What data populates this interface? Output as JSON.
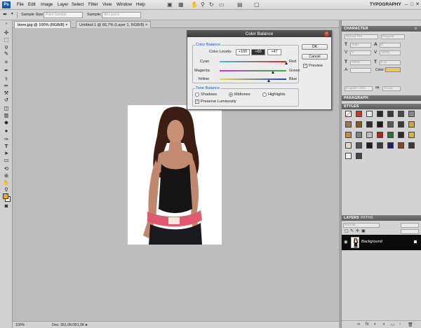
{
  "app": {
    "logo": "Ps"
  },
  "menu": [
    "File",
    "Edit",
    "Image",
    "Layer",
    "Select",
    "Filter",
    "View",
    "Window",
    "Help"
  ],
  "workspace": "TYPOGRAPHY",
  "options": {
    "sample_size_label": "Sample Size:",
    "sample_size_value": "Point Sample",
    "sample_label": "Sample:",
    "sample_value": "All Layers"
  },
  "tabs": [
    "biere.jpg @ 100% (RGB/8)",
    "Untitled-1 @ 66,7% (Layer 1, RGB/8)"
  ],
  "status": {
    "zoom": "100%",
    "doc": "Doc: 351,0K/351,0K"
  },
  "dialog": {
    "title": "Color Balance",
    "color_balance_group": "Color Balance",
    "levels_label": "Color Levels:",
    "levels": [
      "+100",
      "+60",
      "+47"
    ],
    "slider_labels": [
      [
        "Cyan",
        "Red"
      ],
      [
        "Magenta",
        "Green"
      ],
      [
        "Yellow",
        "Blue"
      ]
    ],
    "slider_values": [
      100,
      60,
      47
    ],
    "tone_group": "Tone Balance",
    "tones": [
      "Shadows",
      "Midtones",
      "Highlights"
    ],
    "selected_tone": "Midtones",
    "preserve_label": "Preserve Luminosity",
    "preserve_checked": true,
    "ok": "OK",
    "cancel": "Cancel",
    "preview_label": "Preview",
    "preview_checked": true
  },
  "panels": {
    "character": "CHARACTER",
    "char_fields": [
      "Myriad Pro",
      "Regular",
      "Auto",
      "0",
      "0",
      "100%",
      "100%",
      "0 pt",
      "English: USA",
      "Sharp"
    ],
    "char_color_label": "Color:",
    "char_color": "#f3c55a",
    "paragraph": "PARAGRAPH",
    "styles": "STYLES",
    "layers": "LAYERS",
    "paths": "PATHS",
    "layer_mode": "Normal",
    "layer_name": "Background"
  },
  "colors": {
    "accent": "#1c55b8",
    "foreground": "#f2a81d",
    "background": "#ffffff"
  },
  "icons": {
    "tools": [
      "move-icon",
      "marquee-icon",
      "lasso-icon",
      "quick-selection-icon",
      "crop-icon",
      "eyedropper-icon",
      "healing-brush-icon",
      "brush-icon",
      "clone-stamp-icon",
      "history-brush-icon",
      "eraser-icon",
      "gradient-icon",
      "blur-icon",
      "dodge-icon",
      "pen-icon",
      "type-icon",
      "path-selection-icon",
      "shape-icon",
      "3d-rotate-icon",
      "3d-orbit-icon",
      "hand-icon",
      "zoom-icon"
    ]
  }
}
